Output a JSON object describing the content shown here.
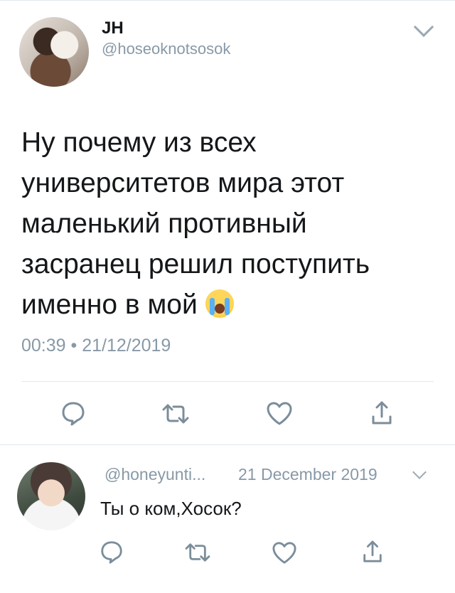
{
  "tweet": {
    "author_name": "JH",
    "author_handle": "@hoseoknotsosok",
    "text_line1": "Ну почему из всех",
    "text_line2": "университетов мира этот",
    "text_line3": "маленький противный",
    "text_line4": "засранец решил поступить",
    "text_line5": "именно в мой",
    "emoji": "loudly-crying-face",
    "timestamp": "00:39 • 21/12/2019"
  },
  "reply": {
    "handle": "@honeyunti...",
    "date": "21 December 2019",
    "text": "Ты о ком,Хосок?"
  },
  "icons": {
    "reply": "comment-icon",
    "retweet": "retweet-icon",
    "like": "heart-icon",
    "share": "share-icon",
    "menu": "chevron-down-icon"
  },
  "colors": {
    "text": "#14171a",
    "secondary": "#8899a6",
    "icon": "#7b8d9a",
    "divider": "#e1e8ed"
  }
}
